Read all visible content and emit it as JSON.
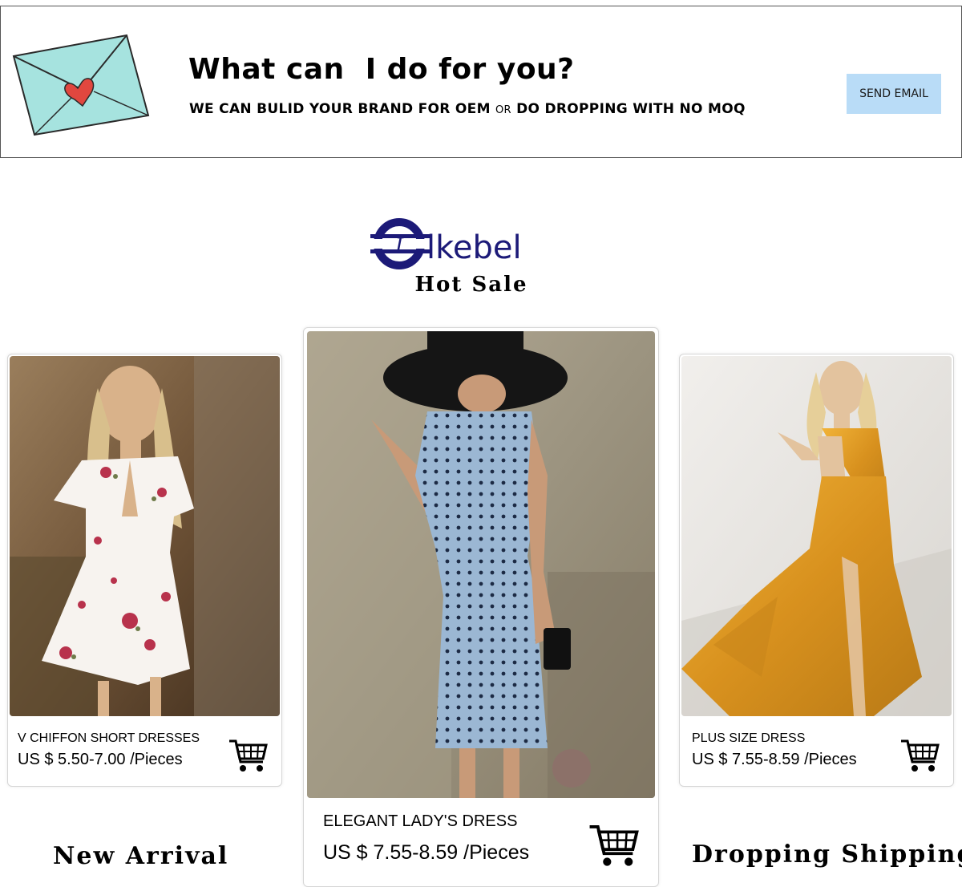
{
  "banner": {
    "title": "What can  I do for you?",
    "subtitle_part1": "WE CAN BULID YOUR BRAND FOR OEM",
    "subtitle_or": "OR",
    "subtitle_part2": "DO DROPPING WITH NO MOQ",
    "button_label": "SEND EMAIL",
    "button_color": "#b9dcf7",
    "icon": "envelope-heart-icon"
  },
  "brand": {
    "logo_text": "lkebel",
    "logo_color": "#1c1a78",
    "section_title": "Hot Sale"
  },
  "products": [
    {
      "name": "V CHIFFON SHORT DRESSES",
      "price": "US $ 5.50-7.00",
      "unit": "/Pieces"
    },
    {
      "name": "ELEGANT LADY'S DRESS",
      "price": "US $ 7.55-8.59",
      "unit": "/Pieces"
    },
    {
      "name": "PLUS SIZE DRESS",
      "price": "US $ 7.55-8.59",
      "unit": "/Pieces"
    }
  ],
  "captions": {
    "left": "New Arrival",
    "right": "Dropping Shipping"
  }
}
